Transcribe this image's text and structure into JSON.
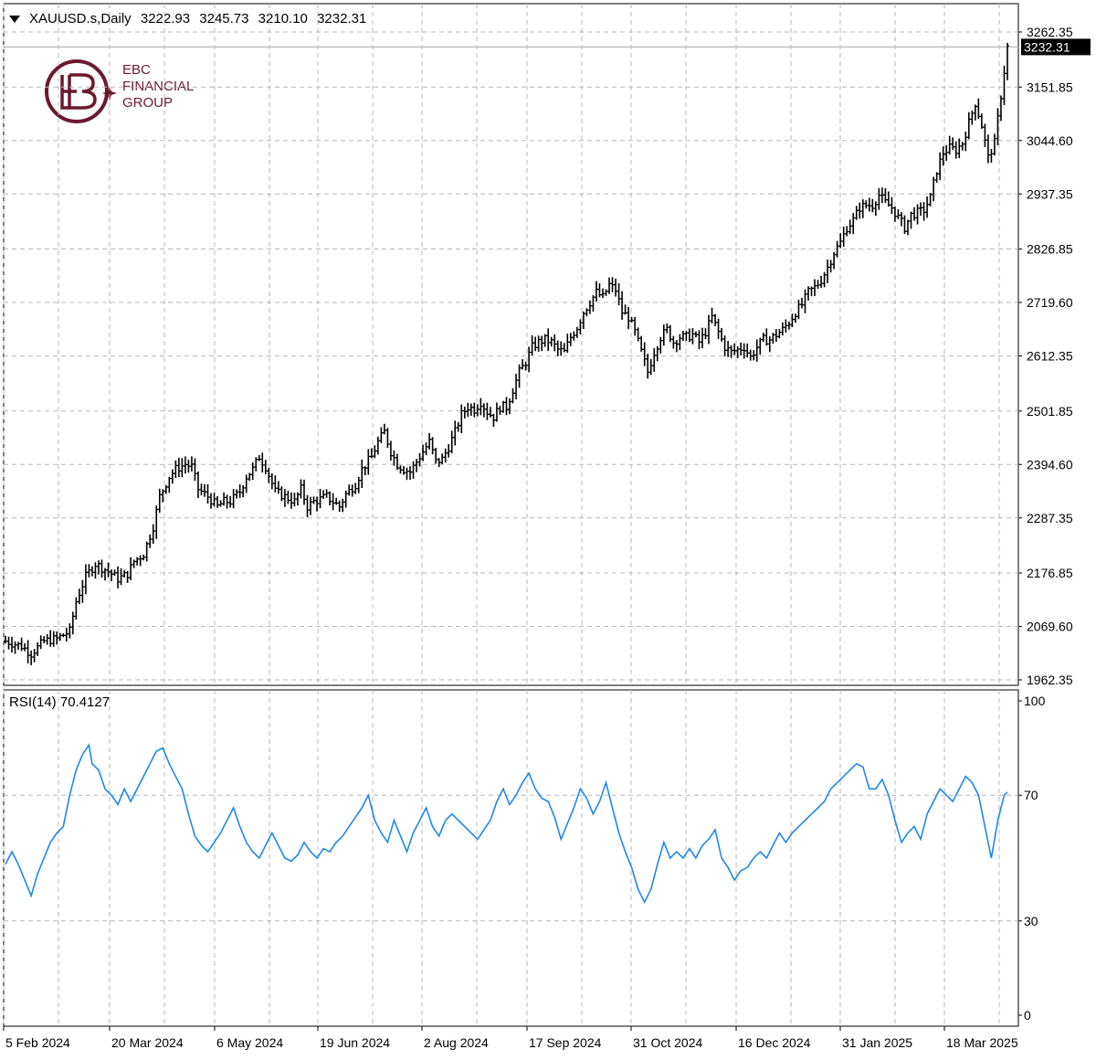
{
  "header": {
    "symbol": "XAUUSD.s,Daily",
    "open": "3222.93",
    "high": "3245.73",
    "low": "3210.10",
    "close": "3232.31"
  },
  "logo": {
    "line1": "EBC",
    "line2": "FINANCIAL",
    "line3": "GROUP",
    "color": "#6b1a2e"
  },
  "rsi": {
    "label": "RSI(14) 70.4127",
    "color": "#1e88e5"
  },
  "chart_data": [
    {
      "type": "ohlc",
      "grid": true,
      "price_axis_ticks": [
        "3262.35",
        "3151.85",
        "3044.60",
        "2937.35",
        "2826.85",
        "2719.60",
        "2612.35",
        "2501.85",
        "2394.60",
        "2287.35",
        "2176.85",
        "2069.60",
        "1962.35"
      ],
      "last_price_label": "3232.31",
      "ylim": [
        1962.35,
        3262.35
      ],
      "x_ticks": [
        "5 Feb 2024",
        "20 Mar 2024",
        "6 May 2024",
        "19 Jun 2024",
        "2 Aug 2024",
        "17 Sep 2024",
        "31 Oct 2024",
        "16 Dec 2024",
        "31 Jan 2025",
        "18 Mar 2025"
      ],
      "close_path": [
        [
          0,
          2040
        ],
        [
          5,
          2030
        ],
        [
          8,
          2015
        ],
        [
          12,
          2040
        ],
        [
          16,
          2045
        ],
        [
          20,
          2060
        ],
        [
          22,
          2120
        ],
        [
          25,
          2170
        ],
        [
          28,
          2195
        ],
        [
          32,
          2180
        ],
        [
          35,
          2165
        ],
        [
          38,
          2175
        ],
        [
          40,
          2200
        ],
        [
          43,
          2215
        ],
        [
          46,
          2270
        ],
        [
          48,
          2330
        ],
        [
          51,
          2370
        ],
        [
          53,
          2385
        ],
        [
          56,
          2395
        ],
        [
          58,
          2390
        ],
        [
          60,
          2345
        ],
        [
          63,
          2330
        ],
        [
          66,
          2310
        ],
        [
          68,
          2320
        ],
        [
          70,
          2320
        ],
        [
          73,
          2340
        ],
        [
          75,
          2370
        ],
        [
          77,
          2385
        ],
        [
          79,
          2410
        ],
        [
          81,
          2390
        ],
        [
          84,
          2340
        ],
        [
          87,
          2330
        ],
        [
          90,
          2320
        ],
        [
          92,
          2345
        ],
        [
          94,
          2310
        ],
        [
          96,
          2320
        ],
        [
          98,
          2325
        ],
        [
          100,
          2330
        ],
        [
          102,
          2320
        ],
        [
          104,
          2310
        ],
        [
          106,
          2335
        ],
        [
          109,
          2355
        ],
        [
          111,
          2385
        ],
        [
          114,
          2410
        ],
        [
          116,
          2440
        ],
        [
          118,
          2460
        ],
        [
          120,
          2420
        ],
        [
          122,
          2395
        ],
        [
          124,
          2385
        ],
        [
          126,
          2380
        ],
        [
          128,
          2400
        ],
        [
          130,
          2420
        ],
        [
          132,
          2440
        ],
        [
          134,
          2400
        ],
        [
          136,
          2405
        ],
        [
          138,
          2430
        ],
        [
          140,
          2460
        ],
        [
          142,
          2495
        ],
        [
          144,
          2510
        ],
        [
          146,
          2505
        ],
        [
          148,
          2520
        ],
        [
          150,
          2500
        ],
        [
          152,
          2490
        ],
        [
          154,
          2510
        ],
        [
          156,
          2510
        ],
        [
          158,
          2545
        ],
        [
          160,
          2580
        ],
        [
          162,
          2600
        ],
        [
          164,
          2630
        ],
        [
          166,
          2640
        ],
        [
          168,
          2645
        ],
        [
          170,
          2640
        ],
        [
          172,
          2625
        ],
        [
          174,
          2620
        ],
        [
          176,
          2650
        ],
        [
          178,
          2670
        ],
        [
          180,
          2700
        ],
        [
          182,
          2720
        ],
        [
          184,
          2740
        ],
        [
          186,
          2730
        ],
        [
          188,
          2755
        ],
        [
          190,
          2745
        ],
        [
          192,
          2700
        ],
        [
          194,
          2690
        ],
        [
          196,
          2660
        ],
        [
          198,
          2620
        ],
        [
          200,
          2580
        ],
        [
          202,
          2620
        ],
        [
          204,
          2650
        ],
        [
          206,
          2665
        ],
        [
          208,
          2640
        ],
        [
          210,
          2650
        ],
        [
          212,
          2650
        ],
        [
          214,
          2655
        ],
        [
          216,
          2640
        ],
        [
          218,
          2660
        ],
        [
          220,
          2690
        ],
        [
          222,
          2660
        ],
        [
          224,
          2630
        ],
        [
          226,
          2620
        ],
        [
          228,
          2625
        ],
        [
          230,
          2630
        ],
        [
          232,
          2610
        ],
        [
          234,
          2630
        ],
        [
          236,
          2645
        ],
        [
          238,
          2645
        ],
        [
          240,
          2655
        ],
        [
          242,
          2665
        ],
        [
          244,
          2680
        ],
        [
          246,
          2700
        ],
        [
          248,
          2715
        ],
        [
          250,
          2740
        ],
        [
          252,
          2750
        ],
        [
          254,
          2765
        ],
        [
          256,
          2790
        ],
        [
          258,
          2820
        ],
        [
          260,
          2840
        ],
        [
          262,
          2870
        ],
        [
          264,
          2885
        ],
        [
          266,
          2910
        ],
        [
          268,
          2915
        ],
        [
          270,
          2915
        ],
        [
          272,
          2935
        ],
        [
          274,
          2920
        ],
        [
          276,
          2910
        ],
        [
          278,
          2890
        ],
        [
          280,
          2870
        ],
        [
          282,
          2895
        ],
        [
          284,
          2900
        ],
        [
          286,
          2905
        ],
        [
          288,
          2930
        ],
        [
          290,
          2985
        ],
        [
          292,
          3020
        ],
        [
          294,
          3030
        ],
        [
          296,
          3025
        ],
        [
          298,
          3040
        ],
        [
          300,
          3080
        ],
        [
          302,
          3120
        ],
        [
          304,
          3075
        ],
        [
          306,
          3010
        ],
        [
          308,
          3040
        ],
        [
          310,
          3135
        ],
        [
          312,
          3232
        ]
      ]
    },
    {
      "type": "line",
      "series": [
        {
          "name": "RSI(14)",
          "color": "#1e88e5"
        }
      ],
      "ylim": [
        0,
        100
      ],
      "y_ticks": [
        "100",
        "70",
        "30",
        "0"
      ],
      "values": [
        [
          0,
          48
        ],
        [
          2,
          52
        ],
        [
          4,
          48
        ],
        [
          6,
          43
        ],
        [
          8,
          38
        ],
        [
          10,
          45
        ],
        [
          12,
          50
        ],
        [
          14,
          55
        ],
        [
          16,
          58
        ],
        [
          18,
          60
        ],
        [
          20,
          70
        ],
        [
          22,
          78
        ],
        [
          24,
          83
        ],
        [
          26,
          86
        ],
        [
          27,
          80
        ],
        [
          29,
          78
        ],
        [
          31,
          72
        ],
        [
          33,
          70
        ],
        [
          35,
          67
        ],
        [
          37,
          72
        ],
        [
          39,
          68
        ],
        [
          41,
          72
        ],
        [
          43,
          76
        ],
        [
          45,
          80
        ],
        [
          47,
          84
        ],
        [
          49,
          85
        ],
        [
          51,
          80
        ],
        [
          53,
          76
        ],
        [
          55,
          72
        ],
        [
          57,
          64
        ],
        [
          59,
          57
        ],
        [
          61,
          54
        ],
        [
          63,
          52
        ],
        [
          65,
          55
        ],
        [
          67,
          58
        ],
        [
          69,
          62
        ],
        [
          71,
          66
        ],
        [
          73,
          60
        ],
        [
          75,
          55
        ],
        [
          77,
          52
        ],
        [
          79,
          50
        ],
        [
          81,
          54
        ],
        [
          83,
          58
        ],
        [
          85,
          54
        ],
        [
          87,
          50
        ],
        [
          89,
          49
        ],
        [
          91,
          51
        ],
        [
          93,
          55
        ],
        [
          95,
          52
        ],
        [
          97,
          50
        ],
        [
          99,
          53
        ],
        [
          101,
          52
        ],
        [
          103,
          55
        ],
        [
          105,
          57
        ],
        [
          107,
          60
        ],
        [
          109,
          63
        ],
        [
          111,
          66
        ],
        [
          113,
          70
        ],
        [
          115,
          62
        ],
        [
          117,
          58
        ],
        [
          119,
          55
        ],
        [
          121,
          62
        ],
        [
          123,
          57
        ],
        [
          125,
          52
        ],
        [
          127,
          58
        ],
        [
          129,
          62
        ],
        [
          131,
          66
        ],
        [
          133,
          60
        ],
        [
          135,
          57
        ],
        [
          137,
          62
        ],
        [
          139,
          64
        ],
        [
          141,
          62
        ],
        [
          143,
          60
        ],
        [
          145,
          58
        ],
        [
          147,
          56
        ],
        [
          149,
          59
        ],
        [
          151,
          62
        ],
        [
          153,
          68
        ],
        [
          155,
          72
        ],
        [
          157,
          67
        ],
        [
          159,
          70
        ],
        [
          161,
          74
        ],
        [
          163,
          77
        ],
        [
          165,
          72
        ],
        [
          167,
          69
        ],
        [
          169,
          68
        ],
        [
          171,
          63
        ],
        [
          173,
          56
        ],
        [
          175,
          61
        ],
        [
          177,
          66
        ],
        [
          179,
          72
        ],
        [
          181,
          69
        ],
        [
          183,
          64
        ],
        [
          185,
          68
        ],
        [
          187,
          74
        ],
        [
          189,
          66
        ],
        [
          191,
          58
        ],
        [
          193,
          52
        ],
        [
          195,
          47
        ],
        [
          197,
          40
        ],
        [
          199,
          36
        ],
        [
          201,
          40
        ],
        [
          203,
          48
        ],
        [
          205,
          55
        ],
        [
          207,
          50
        ],
        [
          209,
          52
        ],
        [
          211,
          50
        ],
        [
          213,
          53
        ],
        [
          215,
          50
        ],
        [
          217,
          54
        ],
        [
          219,
          56
        ],
        [
          221,
          59
        ],
        [
          223,
          50
        ],
        [
          225,
          47
        ],
        [
          227,
          43
        ],
        [
          229,
          46
        ],
        [
          231,
          47
        ],
        [
          233,
          50
        ],
        [
          235,
          52
        ],
        [
          237,
          50
        ],
        [
          239,
          54
        ],
        [
          241,
          58
        ],
        [
          243,
          55
        ],
        [
          245,
          58
        ],
        [
          247,
          60
        ],
        [
          249,
          62
        ],
        [
          251,
          64
        ],
        [
          253,
          66
        ],
        [
          255,
          68
        ],
        [
          257,
          72
        ],
        [
          259,
          74
        ],
        [
          261,
          76
        ],
        [
          263,
          78
        ],
        [
          265,
          80
        ],
        [
          267,
          79
        ],
        [
          269,
          72
        ],
        [
          271,
          72
        ],
        [
          273,
          75
        ],
        [
          275,
          70
        ],
        [
          277,
          62
        ],
        [
          279,
          55
        ],
        [
          281,
          58
        ],
        [
          283,
          60
        ],
        [
          285,
          56
        ],
        [
          287,
          64
        ],
        [
          289,
          68
        ],
        [
          291,
          72
        ],
        [
          293,
          70
        ],
        [
          295,
          68
        ],
        [
          297,
          72
        ],
        [
          299,
          76
        ],
        [
          301,
          74
        ],
        [
          303,
          70
        ],
        [
          305,
          60
        ],
        [
          307,
          50
        ],
        [
          309,
          62
        ],
        [
          311,
          70
        ],
        [
          312,
          71
        ]
      ]
    }
  ]
}
